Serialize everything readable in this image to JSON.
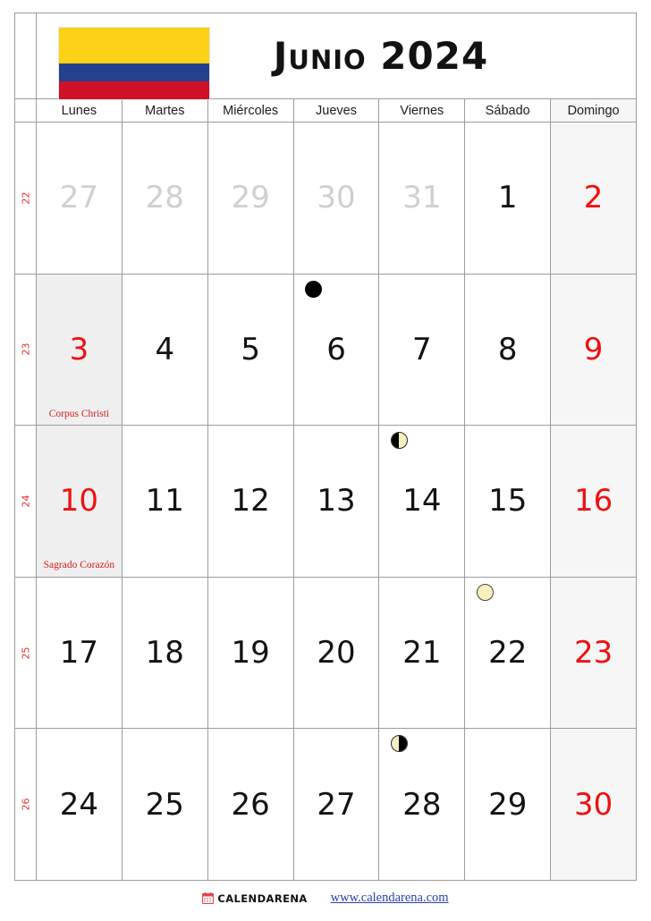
{
  "header": {
    "title": "Junio 2024",
    "flag": {
      "name": "colombia-flag",
      "bands": [
        "#FCD116",
        "#25408F",
        "#CE1126"
      ]
    }
  },
  "weekdays": [
    "Lunes",
    "Martes",
    "Miércoles",
    "Jueves",
    "Viernes",
    "Sábado",
    "Domingo"
  ],
  "colors": {
    "holiday_red": "#ee1111",
    "muted_gray": "#d0d0d0",
    "week_number_red": "#e03030",
    "sunday_bg": "#f6f6f6",
    "holiday_bg": "#efefef",
    "grid_line": "#9b9b9b",
    "link_blue": "#2a3fb5"
  },
  "weeks": [
    {
      "week_number": "22",
      "days": [
        {
          "num": "27",
          "style": "muted",
          "moon": null,
          "holiday": null
        },
        {
          "num": "28",
          "style": "muted",
          "moon": null,
          "holiday": null
        },
        {
          "num": "29",
          "style": "muted",
          "moon": null,
          "holiday": null
        },
        {
          "num": "30",
          "style": "muted",
          "moon": null,
          "holiday": null
        },
        {
          "num": "31",
          "style": "muted",
          "moon": null,
          "holiday": null
        },
        {
          "num": "1",
          "style": "normal",
          "moon": null,
          "holiday": null
        },
        {
          "num": "2",
          "style": "weekend",
          "moon": null,
          "holiday": null
        }
      ]
    },
    {
      "week_number": "23",
      "days": [
        {
          "num": "3",
          "style": "holiday",
          "moon": null,
          "holiday": "Corpus Christi"
        },
        {
          "num": "4",
          "style": "normal",
          "moon": null,
          "holiday": null
        },
        {
          "num": "5",
          "style": "normal",
          "moon": null,
          "holiday": null
        },
        {
          "num": "6",
          "style": "normal",
          "moon": "new",
          "holiday": null
        },
        {
          "num": "7",
          "style": "normal",
          "moon": null,
          "holiday": null
        },
        {
          "num": "8",
          "style": "normal",
          "moon": null,
          "holiday": null
        },
        {
          "num": "9",
          "style": "weekend",
          "moon": null,
          "holiday": null
        }
      ]
    },
    {
      "week_number": "24",
      "days": [
        {
          "num": "10",
          "style": "holiday",
          "moon": null,
          "holiday": "Sagrado Corazón"
        },
        {
          "num": "11",
          "style": "normal",
          "moon": null,
          "holiday": null
        },
        {
          "num": "12",
          "style": "normal",
          "moon": null,
          "holiday": null
        },
        {
          "num": "13",
          "style": "normal",
          "moon": null,
          "holiday": null
        },
        {
          "num": "14",
          "style": "normal",
          "moon": "first-quarter",
          "holiday": null
        },
        {
          "num": "15",
          "style": "normal",
          "moon": null,
          "holiday": null
        },
        {
          "num": "16",
          "style": "weekend",
          "moon": null,
          "holiday": null
        }
      ]
    },
    {
      "week_number": "25",
      "days": [
        {
          "num": "17",
          "style": "normal",
          "moon": null,
          "holiday": null
        },
        {
          "num": "18",
          "style": "normal",
          "moon": null,
          "holiday": null
        },
        {
          "num": "19",
          "style": "normal",
          "moon": null,
          "holiday": null
        },
        {
          "num": "20",
          "style": "normal",
          "moon": null,
          "holiday": null
        },
        {
          "num": "21",
          "style": "normal",
          "moon": null,
          "holiday": null
        },
        {
          "num": "22",
          "style": "normal",
          "moon": "full",
          "holiday": null
        },
        {
          "num": "23",
          "style": "weekend",
          "moon": null,
          "holiday": null
        }
      ]
    },
    {
      "week_number": "26",
      "days": [
        {
          "num": "24",
          "style": "normal",
          "moon": null,
          "holiday": null
        },
        {
          "num": "25",
          "style": "normal",
          "moon": null,
          "holiday": null
        },
        {
          "num": "26",
          "style": "normal",
          "moon": null,
          "holiday": null
        },
        {
          "num": "27",
          "style": "normal",
          "moon": null,
          "holiday": null
        },
        {
          "num": "28",
          "style": "normal",
          "moon": "last-quarter",
          "holiday": null
        },
        {
          "num": "29",
          "style": "normal",
          "moon": null,
          "holiday": null
        },
        {
          "num": "30",
          "style": "weekend",
          "moon": null,
          "holiday": null
        }
      ]
    }
  ],
  "footer": {
    "brand_name": "CALENDARENA",
    "brand_icon": "calendar-icon",
    "site_url": "www.calendarena.com"
  }
}
